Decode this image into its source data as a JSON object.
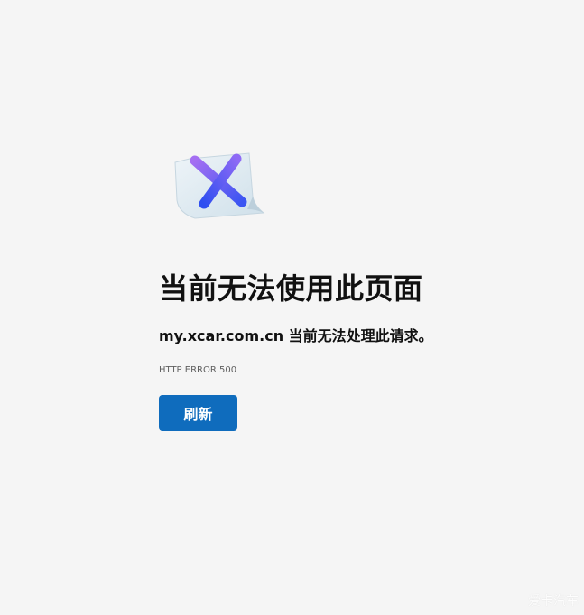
{
  "icon": {
    "name": "error-page-x-icon",
    "accent_colors": [
      "#7b5cf5",
      "#3f5bf5",
      "#d8e6ee"
    ]
  },
  "title": "当前无法使用此页面",
  "message": {
    "host": "my.xcar.com.cn",
    "text": " 当前无法处理此请求。"
  },
  "error_code": "HTTP ERROR 500",
  "reload_button": {
    "label": "刷新",
    "color": "#0f6cbd"
  },
  "watermark": "爱卡汽车"
}
